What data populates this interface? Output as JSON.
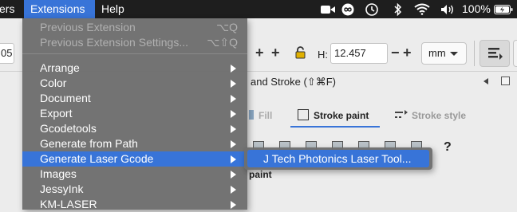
{
  "menubar": {
    "items": [
      "ers",
      "Extensions",
      "Help"
    ],
    "battery": "100%",
    "status_icons": [
      "video-icon",
      "infinity-icon",
      "time-machine-icon",
      "bluetooth-icon",
      "wifi-icon",
      "volume-icon",
      "battery-icon"
    ]
  },
  "toolbar": {
    "x_value": "05",
    "h_label": "H:",
    "h_value": "12.457",
    "unit": "mm",
    "plus": "+",
    "minus": "−",
    "ruler_fragment": "| | | | | |"
  },
  "panel": {
    "title_fragment": "and Stroke (⇧⌘F)",
    "tabs": [
      "Fill",
      "Stroke paint",
      "Stroke style"
    ],
    "question": "?",
    "paint_fragment": "paint"
  },
  "menu": {
    "items": [
      {
        "label": "Previous Extension",
        "shortcut": "⌥Q",
        "disabled": true
      },
      {
        "label": "Previous Extension Settings...",
        "shortcut": "⌥⇧Q",
        "disabled": true
      },
      {
        "label": "Arrange"
      },
      {
        "label": "Color"
      },
      {
        "label": "Document"
      },
      {
        "label": "Export"
      },
      {
        "label": "Gcodetools"
      },
      {
        "label": "Generate from Path"
      },
      {
        "label": "Generate Laser Gcode",
        "highlighted": true
      },
      {
        "label": "Images"
      },
      {
        "label": "JessyInk"
      },
      {
        "label": "KM-LASER"
      }
    ],
    "submenu_item": "J Tech Photonics Laser Tool..."
  },
  "colors": {
    "highlight": "#3874d8",
    "menu_bg": "#6e6e6e",
    "menubar_bg": "#1e1e1e"
  }
}
